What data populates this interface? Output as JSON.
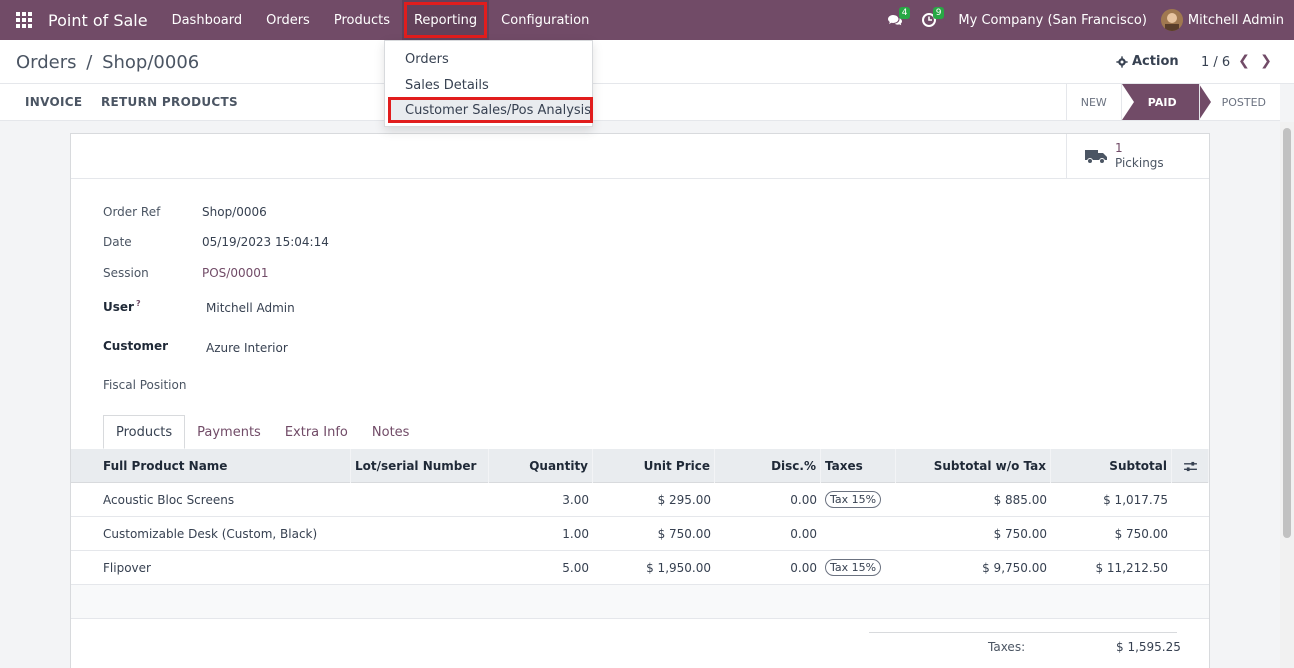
{
  "navbar": {
    "app_title": "Point of Sale",
    "menu": [
      "Dashboard",
      "Orders",
      "Products",
      "Reporting",
      "Configuration"
    ],
    "messages_count": "4",
    "activities_count": "9",
    "company": "My Company (San Francisco)",
    "user": "Mitchell Admin"
  },
  "reporting_menu": {
    "items": [
      "Orders",
      "Sales Details",
      "Customer Sales/Pos Analysis"
    ]
  },
  "breadcrumb": {
    "parent": "Orders",
    "separator": "/",
    "current": "Shop/0006"
  },
  "control": {
    "action_label": "Action",
    "pager": "1 / 6"
  },
  "statusbar": {
    "invoice_label": "INVOICE",
    "return_label": "RETURN PRODUCTS",
    "steps": [
      "NEW",
      "PAID",
      "POSTED"
    ]
  },
  "smart_button": {
    "count": "1",
    "label": "Pickings"
  },
  "form": {
    "order_ref_label": "Order Ref",
    "order_ref": "Shop/0006",
    "date_label": "Date",
    "date": "05/19/2023 15:04:14",
    "session_label": "Session",
    "session": "POS/00001",
    "user_label": "User",
    "user_help": "?",
    "user": "Mitchell Admin",
    "customer_label": "Customer",
    "customer": "Azure Interior",
    "fiscal_label": "Fiscal Position",
    "fiscal": ""
  },
  "tabs": [
    "Products",
    "Payments",
    "Extra Info",
    "Notes"
  ],
  "table": {
    "headers": [
      "Full Product Name",
      "Lot/serial Number",
      "Quantity",
      "Unit Price",
      "Disc.%",
      "Taxes",
      "Subtotal w/o Tax",
      "Subtotal"
    ],
    "rows": [
      {
        "name": "Acoustic Bloc Screens",
        "lot": "",
        "qty": "3.00",
        "price": "$ 295.00",
        "disc": "0.00",
        "tax": "Tax 15%",
        "subtotal_wo": "$ 885.00",
        "subtotal": "$ 1,017.75"
      },
      {
        "name": "Customizable Desk (Custom, Black)",
        "lot": "",
        "qty": "1.00",
        "price": "$ 750.00",
        "disc": "0.00",
        "tax": "",
        "subtotal_wo": "$ 750.00",
        "subtotal": "$ 750.00"
      },
      {
        "name": "Flipover",
        "lot": "",
        "qty": "5.00",
        "price": "$ 1,950.00",
        "disc": "0.00",
        "tax": "Tax 15%",
        "subtotal_wo": "$ 9,750.00",
        "subtotal": "$ 11,212.50"
      }
    ]
  },
  "totals": {
    "taxes_label": "Taxes:",
    "taxes": "$ 1,595.25"
  },
  "colors": {
    "brand": "#714b67",
    "highlight": "#e11d1d",
    "badge": "#28a745"
  }
}
